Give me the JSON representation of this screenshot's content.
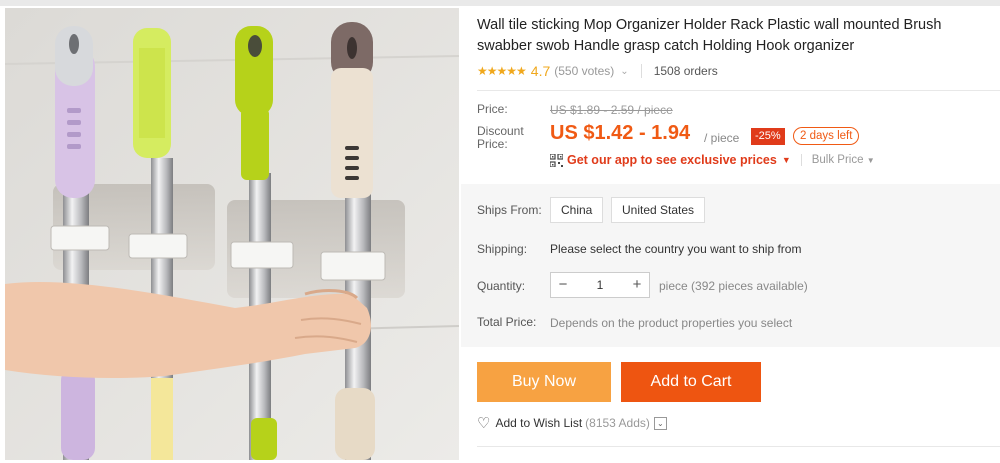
{
  "product": {
    "title": "Wall tile sticking Mop Organizer Holder Rack Plastic wall mounted Brush swabber swob Handle grasp catch Holding Hook organizer",
    "image_alt": "mop organizer holder product photo"
  },
  "rating": {
    "stars": "★★★★★",
    "value": "4.7",
    "votes": "(550 votes)",
    "orders": "1508 orders"
  },
  "price": {
    "price_label": "Price:",
    "original": "US $1.89 - 2.59 / piece",
    "discount_label": "Discount\nPrice:",
    "discount": "US $1.42 - 1.94",
    "unit": "/ piece",
    "off_badge": "-25%",
    "time_badge": "2 days left",
    "app_link": "Get our app to see exclusive prices",
    "bulk": "Bulk Price"
  },
  "shipping": {
    "ships_from_label": "Ships From:",
    "options": [
      "China",
      "United States"
    ],
    "shipping_label": "Shipping:",
    "shipping_text": "Please select the country you want to ship from"
  },
  "quantity": {
    "label": "Quantity:",
    "minus": "−",
    "value": "1",
    "plus": "+",
    "available": "piece (392 pieces available)"
  },
  "total": {
    "label": "Total Price:",
    "text": "Depends on the product properties you select"
  },
  "actions": {
    "buy_now": "Buy Now",
    "add_to_cart": "Add to Cart",
    "wish_list": "Add to Wish List",
    "wish_count": "(8153 Adds)"
  },
  "colors": {
    "accent": "#f05a14",
    "buy_now": "#f7a242",
    "add_to_cart": "#ee5511",
    "stars": "#f0a81d"
  }
}
